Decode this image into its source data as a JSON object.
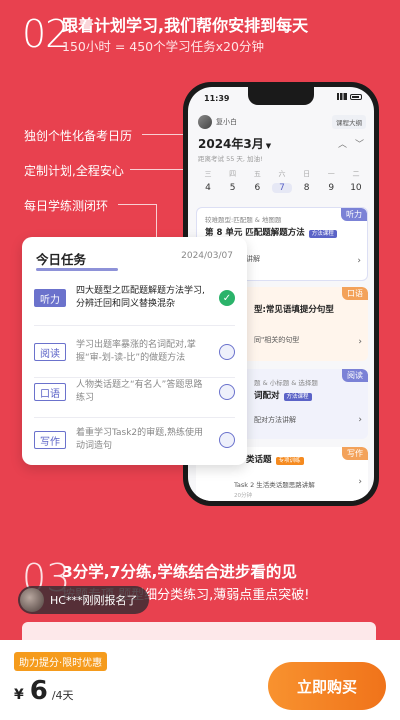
{
  "section2": {
    "number": "02",
    "title": "跟着计划学习,我们帮你安排到每天",
    "subtitle": "150小时 = 450个学习任务x20分钟"
  },
  "features": [
    "独创个性化备考日历",
    "定制计划,全程安心",
    "每日学练测闭环"
  ],
  "phone": {
    "time": "11:39",
    "user": "复小白",
    "outline_btn": "课程大纲",
    "month": "2024年3月",
    "exam_note": "距离考试 55 天, 加油!",
    "weekdays": [
      "三",
      "四",
      "五",
      "六",
      "日",
      "一",
      "二"
    ],
    "dates": [
      "4",
      "5",
      "6",
      "7",
      "8",
      "9",
      "10"
    ],
    "selected_date": "7",
    "cards": [
      {
        "tag": "听力",
        "line1": "较难题型:匹配题 & 地图题",
        "line2": "第 8 单元 匹配题解题方法",
        "mini": "方法课程",
        "line3": "题解题方法讲解"
      },
      {
        "tag": "口语",
        "line2": "型:常见语填提分句型",
        "line3": "同\"相关的句型"
      },
      {
        "tag": "阅读",
        "line1": "题 & 小标题 & 选择题",
        "line2": "词配对",
        "mini": "方法课程",
        "line3": "配对方法讲解"
      },
      {
        "tag": "写作",
        "line2": "类话题",
        "mini": "专项训练",
        "line3": "Task 2 生活类话题思路讲解",
        "line4": "20分钟"
      }
    ]
  },
  "today": {
    "title": "今日任务",
    "date": "2024/03/07",
    "items": [
      {
        "tag": "听力",
        "text": "四大题型之匹配题解题方法学习,分辨迁回和同义替换混杂",
        "done": true
      },
      {
        "tag": "阅读",
        "text": "学习出题率暴涨的名词配对,掌握“审-划-读-比”的做题方法",
        "done": false
      },
      {
        "tag": "口语",
        "text": "人物类话题之“有名人”答题思路练习",
        "done": false
      },
      {
        "tag": "写作",
        "text": "着重学习Task2的审题,熟练使用动词造句",
        "done": false
      }
    ]
  },
  "section3": {
    "number": "03",
    "title": "3分学,7分练,学练结合进步看的见",
    "subtitle": "按题专项,题型细分类练习,薄弱点重点突破!"
  },
  "toast": {
    "text": "HC***刚刚报名了"
  },
  "bottom": {
    "promo": "助力提分·限时优惠",
    "currency": "¥",
    "price": "6",
    "unit": "/4天",
    "buy": "立即购买"
  }
}
